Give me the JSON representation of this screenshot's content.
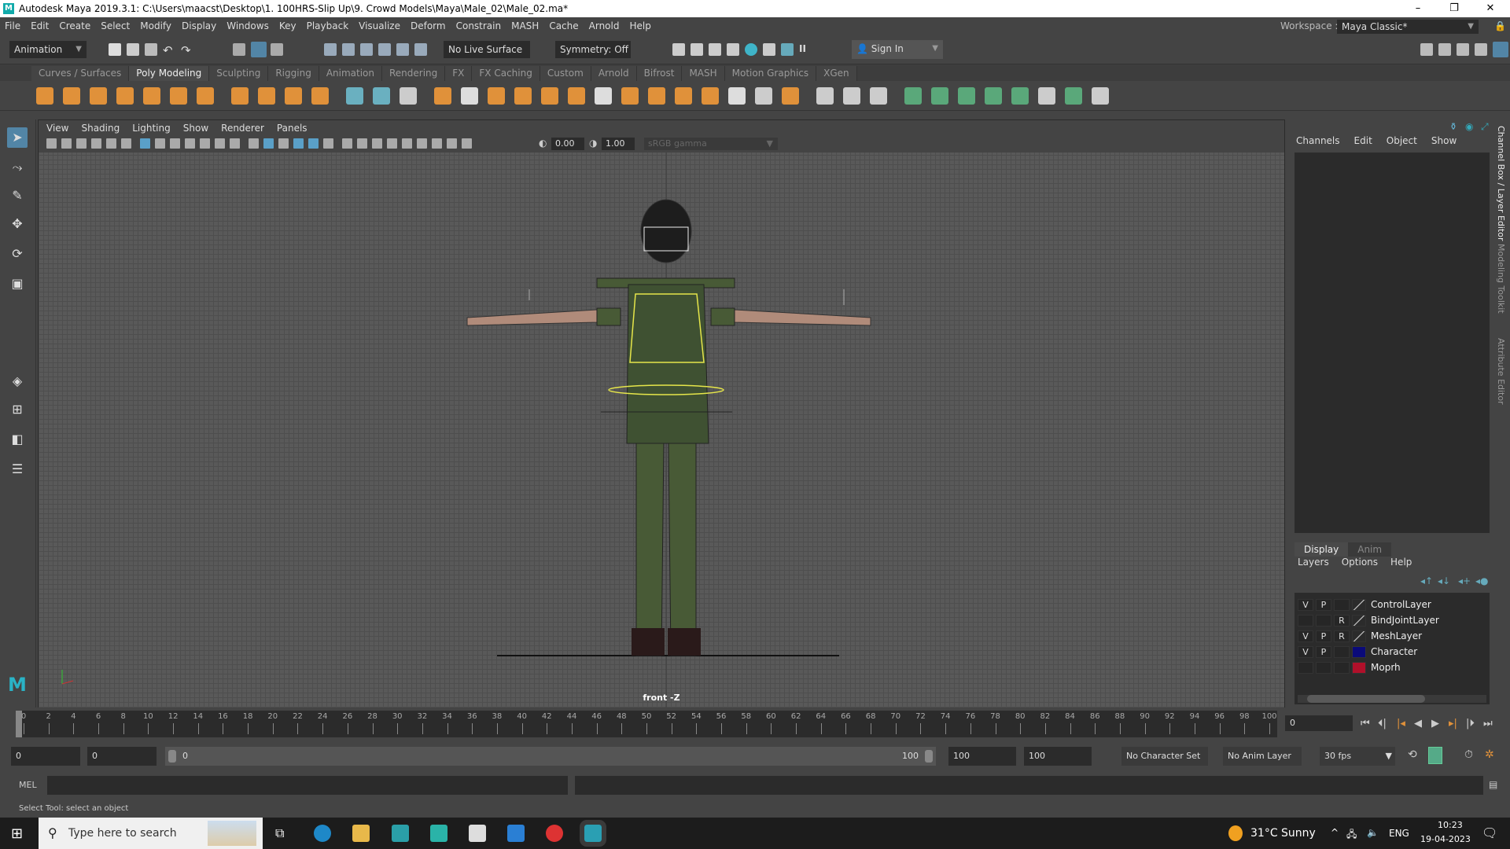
{
  "title": "Autodesk Maya 2019.3.1: C:\\Users\\maacst\\Desktop\\1. 100HRS-Slip Up\\9. Crowd Models\\Maya\\Male_02\\Male_02.ma*",
  "window_controls": {
    "minimize": "–",
    "restore": "❐",
    "close": "✕"
  },
  "menu": [
    "File",
    "Edit",
    "Create",
    "Select",
    "Modify",
    "Display",
    "Windows",
    "Key",
    "Playback",
    "Visualize",
    "Deform",
    "Constrain",
    "MASH",
    "Cache",
    "Arnold",
    "Help"
  ],
  "workspace": {
    "label": "Workspace :",
    "value": "Maya Classic*"
  },
  "statusline": {
    "menuset": "Animation",
    "live_surface": "No Live Surface",
    "symmetry": "Symmetry: Off",
    "sign_in": "Sign In"
  },
  "shelf_tabs": [
    "Curves / Surfaces",
    "Poly Modeling",
    "Sculpting",
    "Rigging",
    "Animation",
    "Rendering",
    "FX",
    "FX Caching",
    "Custom",
    "Arnold",
    "Bifrost",
    "MASH",
    "Motion Graphics",
    "XGen"
  ],
  "active_shelf": "Poly Modeling",
  "shelf_icons": [
    {
      "name": "poly-sphere-icon",
      "color": "#e0913a"
    },
    {
      "name": "poly-cube-icon",
      "color": "#e0913a"
    },
    {
      "name": "poly-cylinder-icon",
      "color": "#e0913a"
    },
    {
      "name": "poly-cone-icon",
      "color": "#e0913a"
    },
    {
      "name": "poly-torus-icon",
      "color": "#e0913a"
    },
    {
      "name": "poly-plane-icon",
      "color": "#e0913a"
    },
    {
      "name": "poly-disc-icon",
      "color": "#e0913a"
    },
    {
      "name": "platonic-solid-icon",
      "color": "#e0913a"
    },
    {
      "name": "sweep-mesh-icon",
      "color": "#e0913a"
    },
    {
      "name": "type-icon",
      "color": "#e0913a"
    },
    {
      "name": "svg-icon",
      "color": "#e0913a"
    },
    {
      "name": "mirror-icon",
      "color": "#6ab0c0"
    },
    {
      "name": "sculpt-icon",
      "color": "#6ab0c0"
    },
    {
      "name": "mesh-snap-icon",
      "color": "#ccc"
    },
    {
      "name": "combine-icon",
      "color": "#e0913a"
    },
    {
      "name": "separate-icon",
      "color": "#ddd"
    },
    {
      "name": "extract-icon",
      "color": "#e0913a"
    },
    {
      "name": "smooth-icon",
      "color": "#e0913a"
    },
    {
      "name": "boolean-icon",
      "color": "#e0913a"
    },
    {
      "name": "extrude-icon",
      "color": "#e0913a"
    },
    {
      "name": "bridge-icon",
      "color": "#ddd"
    },
    {
      "name": "bevel-icon",
      "color": "#e0913a"
    },
    {
      "name": "fill-hole-icon",
      "color": "#e0913a"
    },
    {
      "name": "target-weld-icon",
      "color": "#e0913a"
    },
    {
      "name": "connect-icon",
      "color": "#e0913a"
    },
    {
      "name": "bevel-edge-icon",
      "color": "#ddd"
    },
    {
      "name": "multi-cut-icon",
      "color": "#ccc"
    },
    {
      "name": "quad-draw-icon",
      "color": "#e0913a"
    },
    {
      "name": "edge-loop-icon",
      "color": "#ccc"
    },
    {
      "name": "insert-loop-icon",
      "color": "#ccc"
    },
    {
      "name": "offset-loop-icon",
      "color": "#ccc"
    },
    {
      "name": "uv-planar-icon",
      "color": "#5aa87a"
    },
    {
      "name": "uv-cylinder-icon",
      "color": "#5aa87a"
    },
    {
      "name": "uv-sphere-icon",
      "color": "#5aa87a"
    },
    {
      "name": "uv-auto-icon",
      "color": "#5aa87a"
    },
    {
      "name": "uv-contour-icon",
      "color": "#5aa87a"
    },
    {
      "name": "uv-editor-icon",
      "color": "#ccc"
    },
    {
      "name": "uv-cut-icon",
      "color": "#5aa87a"
    },
    {
      "name": "uv-sew-icon",
      "color": "#ccc"
    }
  ],
  "panel_menu": [
    "View",
    "Shading",
    "Lighting",
    "Show",
    "Renderer",
    "Panels"
  ],
  "viewport_toolbar": {
    "exposure": "0.00",
    "gamma": "1.00",
    "color_space": "sRGB gamma"
  },
  "camera_label": "front -Z",
  "channel_box": {
    "menu": [
      "Channels",
      "Edit",
      "Object",
      "Show"
    ]
  },
  "side_tabs": [
    "Channel Box / Layer Editor",
    "Modeling Toolkit",
    "Attribute Editor"
  ],
  "layer_editor": {
    "tabs": [
      "Display",
      "Anim"
    ],
    "menu": [
      "Layers",
      "Options",
      "Help"
    ],
    "layers": [
      {
        "v": "V",
        "p": "P",
        "r": "",
        "name": "ControlLayer",
        "color": ""
      },
      {
        "v": "",
        "p": "",
        "r": "R",
        "name": "BindJointLayer",
        "color": ""
      },
      {
        "v": "V",
        "p": "P",
        "r": "R",
        "name": "MeshLayer",
        "color": ""
      },
      {
        "v": "V",
        "p": "P",
        "r": "",
        "name": "Character",
        "color": "#0a0a7a"
      },
      {
        "v": "",
        "p": "",
        "r": "",
        "name": "Moprh",
        "color": "#b0102a"
      }
    ]
  },
  "timeline": {
    "start": 0,
    "end": 100,
    "step": 2,
    "current": 0,
    "current_frame_field": "0"
  },
  "range": {
    "anim_start": "0",
    "play_start": "0",
    "slider_start": "0",
    "slider_end": "100",
    "play_end": "100",
    "anim_end": "100",
    "character_set": "No Character Set",
    "anim_layer": "No Anim Layer",
    "fps": "30 fps"
  },
  "mel": {
    "label": "MEL"
  },
  "help_line": "Select Tool: select an object",
  "taskbar": {
    "search_placeholder": "Type here to search",
    "weather": "31°C  Sunny",
    "lang": "ENG",
    "time": "10:23",
    "date": "19-04-2023"
  }
}
